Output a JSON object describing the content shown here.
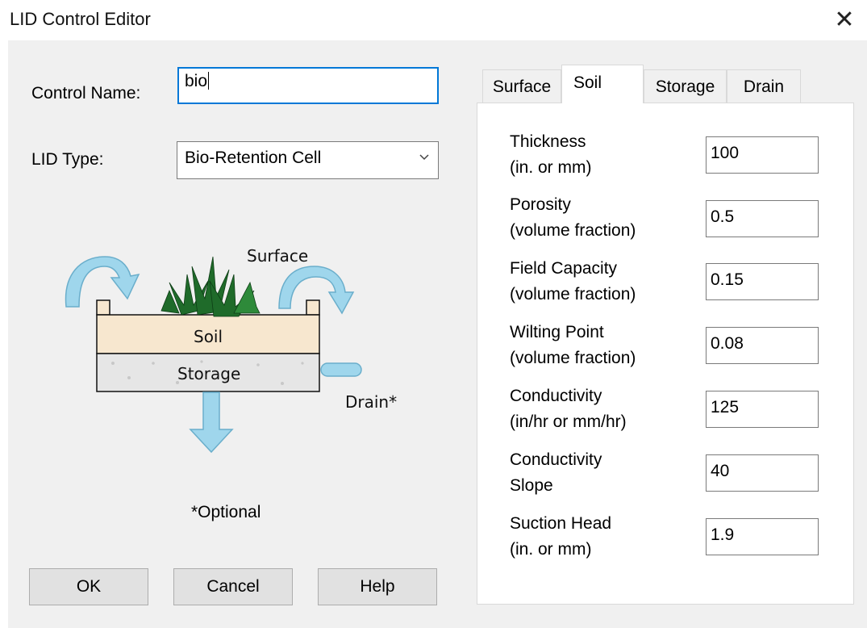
{
  "window": {
    "title": "LID Control Editor",
    "close_glyph": "✕"
  },
  "form": {
    "control_name_label": "Control Name:",
    "control_name_value": "bio",
    "lid_type_label": "LID Type:",
    "lid_type_value": "Bio-Retention Cell"
  },
  "diagram": {
    "surface_label": "Surface",
    "soil_label": "Soil",
    "storage_label": "Storage",
    "drain_label": "Drain*",
    "optional_note": "*Optional"
  },
  "tabs": [
    {
      "label": "Surface",
      "active": false
    },
    {
      "label": "Soil",
      "active": true
    },
    {
      "label": "Storage",
      "active": false
    },
    {
      "label": "Drain",
      "active": false
    }
  ],
  "soil_fields": [
    {
      "line1": "Thickness",
      "line2": "(in. or mm)",
      "value": "100"
    },
    {
      "line1": "Porosity",
      "line2": "(volume fraction)",
      "value": "0.5"
    },
    {
      "line1": "Field Capacity",
      "line2": "(volume fraction)",
      "value": "0.15"
    },
    {
      "line1": "Wilting Point",
      "line2": "(volume fraction)",
      "value": "0.08"
    },
    {
      "line1": "Conductivity",
      "line2": "(in/hr or mm/hr)",
      "value": "125"
    },
    {
      "line1": "Conductivity",
      "line2": "Slope",
      "value": "40"
    },
    {
      "line1": "Suction Head",
      "line2": "(in. or mm)",
      "value": "1.9"
    }
  ],
  "buttons": {
    "ok": "OK",
    "cancel": "Cancel",
    "help": "Help"
  },
  "colors": {
    "focus_border": "#0078d7",
    "arrow_fill": "#9fd6ec",
    "soil_fill": "#f7e7cf",
    "storage_fill": "#e6e6e6",
    "plant_green": "#1f6b2a"
  }
}
